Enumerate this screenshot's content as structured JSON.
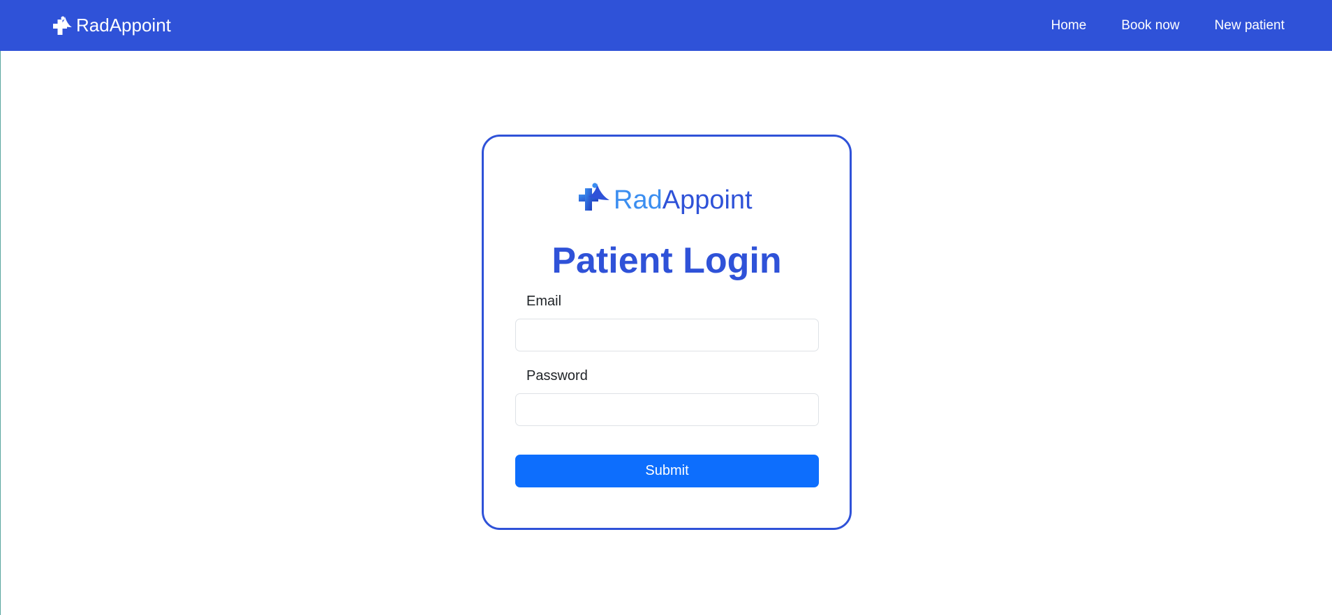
{
  "navbar": {
    "brand": "RadAppoint",
    "brand_icon": "medical-cross-person-icon",
    "links": [
      {
        "label": "Home"
      },
      {
        "label": "Book now"
      },
      {
        "label": "New patient"
      }
    ],
    "background_color": "#2f52d8"
  },
  "login_card": {
    "logo_rad": "Rad",
    "logo_appoint": "Appoint",
    "logo_icon": "medical-cross-person-icon",
    "title": "Patient Login",
    "email_label": "Email",
    "email_value": "",
    "password_label": "Password",
    "password_value": "",
    "submit_label": "Submit",
    "border_color": "#2f52d8",
    "submit_color": "#0d6efd"
  }
}
